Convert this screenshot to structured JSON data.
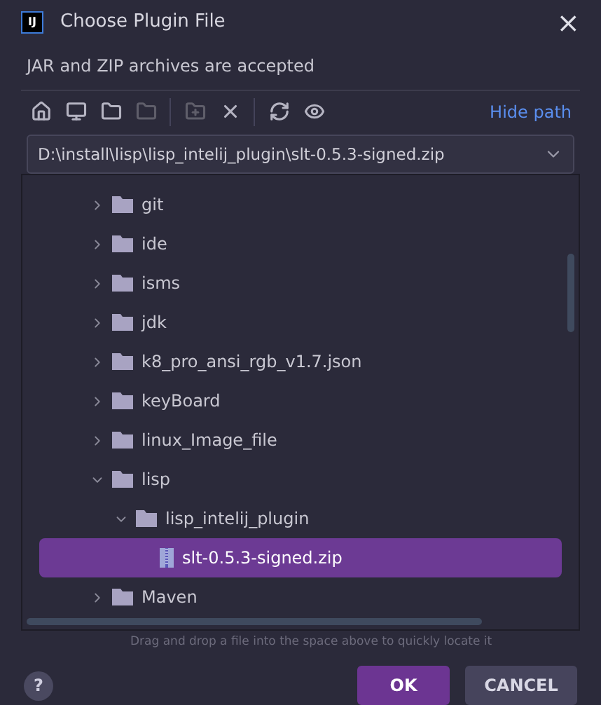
{
  "window": {
    "logo": "IJ",
    "title": "Choose Plugin File",
    "close": "×"
  },
  "description": "JAR and ZIP archives are accepted",
  "toolbar": [
    {
      "kind": "home",
      "disabled": false
    },
    {
      "kind": "desktop",
      "disabled": false
    },
    {
      "kind": "folder",
      "disabled": false
    },
    {
      "kind": "folder",
      "disabled": true
    },
    {
      "kind": "separator"
    },
    {
      "kind": "new-folder",
      "disabled": true
    },
    {
      "kind": "delete",
      "disabled": false
    },
    {
      "kind": "separator"
    },
    {
      "kind": "refresh",
      "disabled": false
    },
    {
      "kind": "hidden",
      "disabled": false
    }
  ],
  "hide_path": "Hide path",
  "path": "D:\\install\\lisp\\lisp_intelij_plugin\\slt-0.5.3-signed.zip",
  "tree": [
    {
      "label": "git",
      "kind": "folder",
      "expanded": false,
      "selected": false
    },
    {
      "label": "ide",
      "kind": "folder",
      "expanded": false,
      "selected": false
    },
    {
      "label": "isms",
      "kind": "folder",
      "expanded": false,
      "selected": false
    },
    {
      "label": "jdk",
      "kind": "folder",
      "expanded": false,
      "selected": false
    },
    {
      "label": "k8_pro_ansi_rgb_v1.7.json",
      "kind": "folder",
      "expanded": false,
      "selected": false
    },
    {
      "label": "keyBoard",
      "kind": "folder",
      "expanded": false,
      "selected": false
    },
    {
      "label": "linux_Image_file",
      "kind": "folder",
      "expanded": false,
      "selected": false
    },
    {
      "label": "lisp",
      "kind": "folder",
      "expanded": true,
      "selected": false,
      "children": [
        {
          "label": "lisp_intelij_plugin",
          "kind": "folder",
          "expanded": true,
          "selected": false,
          "children": [
            {
              "label": "slt-0.5.3-signed.zip",
              "kind": "archive",
              "selected": true
            }
          ]
        }
      ]
    },
    {
      "label": "Maven",
      "kind": "folder",
      "expanded": false,
      "selected": false
    }
  ],
  "hint": "Drag and drop a file into the space above to quickly locate it",
  "help": "?",
  "buttons": [
    {
      "label": "OK",
      "primary": true
    },
    {
      "label": "CANCEL",
      "primary": false
    }
  ]
}
